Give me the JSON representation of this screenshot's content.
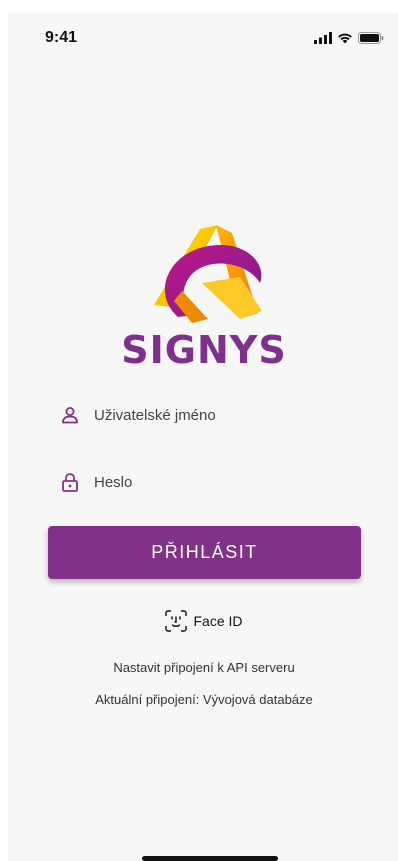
{
  "status_bar": {
    "time": "9:41",
    "icons": [
      "signal-icon",
      "wifi-icon",
      "battery-icon"
    ]
  },
  "brand": {
    "name": "SIGNYS",
    "color": "#7f2f8c"
  },
  "login_form": {
    "username_placeholder": "Uživatelské jméno",
    "password_placeholder": "Heslo",
    "submit_label": "PŘIHLÁSIT",
    "faceid_label": "Face ID"
  },
  "api": {
    "setup_link": "Nastavit připojení k API serveru",
    "current_connection": "Aktuální připojení: Vývojová databáze"
  },
  "colors": {
    "accent": "#823189",
    "background": "#f7f7f7"
  }
}
